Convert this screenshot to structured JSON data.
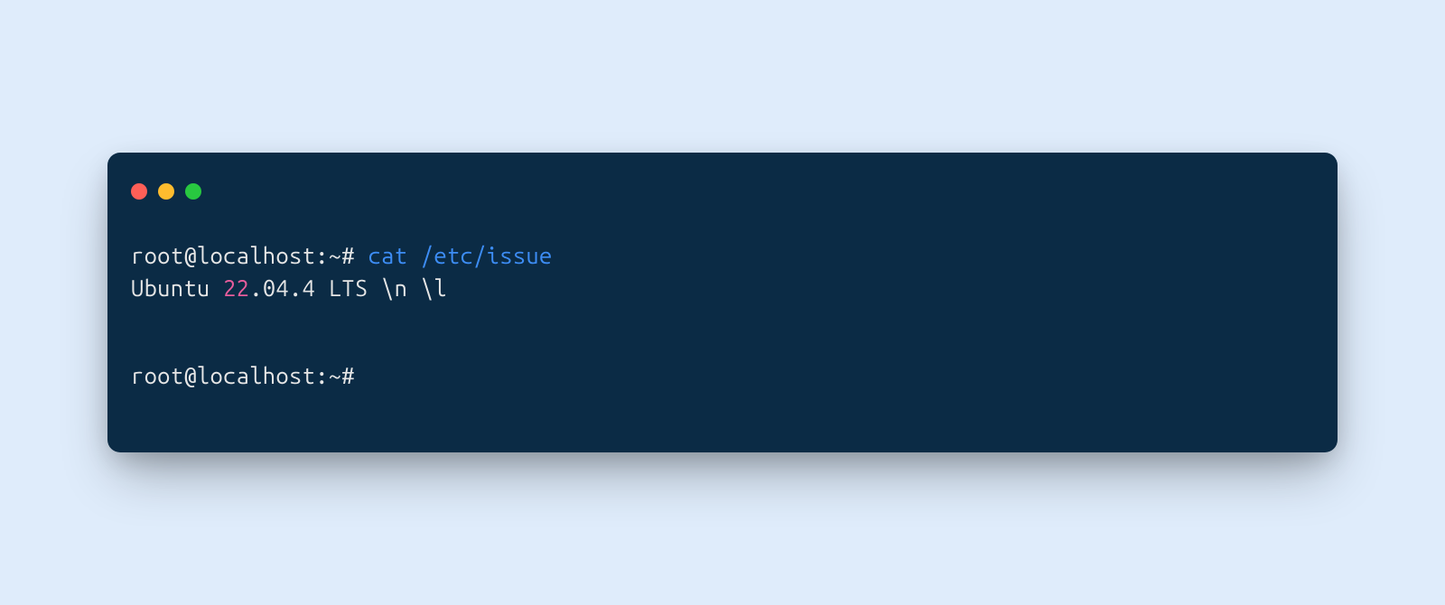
{
  "terminal": {
    "prompt1": "root@localhost:~# ",
    "command1": "cat /etc/issue",
    "output_prefix": "Ubuntu ",
    "output_number": "22",
    "output_suffix": ".04.4 LTS \\n \\l",
    "prompt2": "root@localhost:~#"
  },
  "colors": {
    "background_page": "#dfecfb",
    "background_terminal": "#0b2b45",
    "dot_red": "#ff5f57",
    "dot_yellow": "#febc2e",
    "dot_green": "#28c840",
    "text_default": "#e6e6e6",
    "text_command": "#3d8df5",
    "text_number": "#e85d9c"
  }
}
